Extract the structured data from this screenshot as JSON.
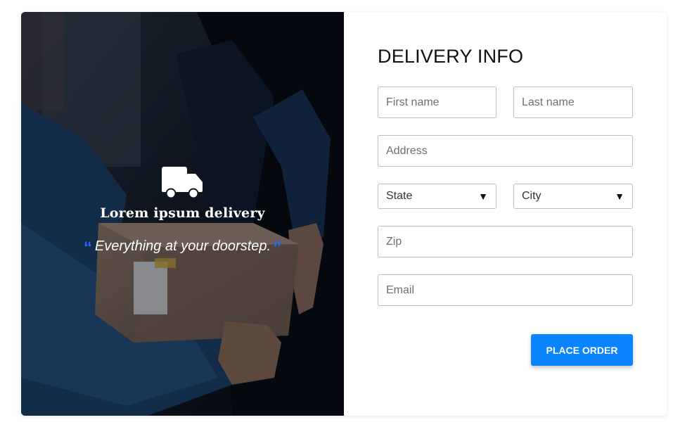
{
  "hero": {
    "icon": "truck-icon",
    "brand": "Lorem ipsum delivery",
    "tagline": "Everything at your doorstep.",
    "quote_color": "#1f6bff"
  },
  "form": {
    "title": "DELIVERY INFO",
    "first_name_placeholder": "First name",
    "last_name_placeholder": "Last name",
    "address_placeholder": "Address",
    "state_selected": "State",
    "city_selected": "City",
    "zip_placeholder": "Zip",
    "email_placeholder": "Email",
    "submit_label": "PLACE ORDER"
  },
  "colors": {
    "accent": "#0a84ff",
    "border": "#bdbdbd",
    "title": "#111111"
  }
}
